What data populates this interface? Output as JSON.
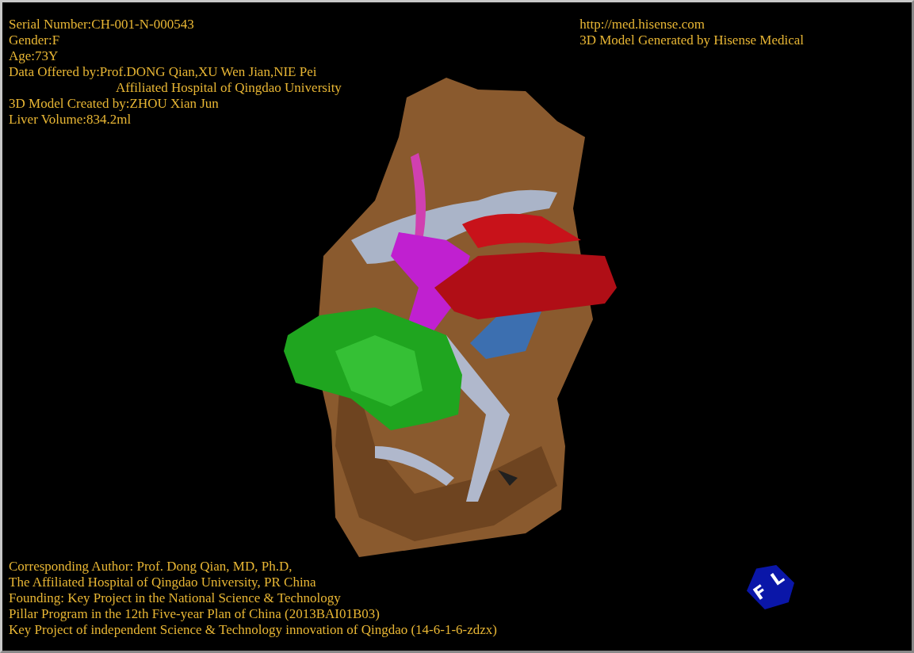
{
  "viewer": {
    "info_lines": [
      {
        "text": "Serial Number:CH-001-N-000543",
        "indented": false
      },
      {
        "text": "Gender:F",
        "indented": false
      },
      {
        "text": "Age:73Y",
        "indented": false
      },
      {
        "text": "Data Offered by:Prof.DONG Qian,XU Wen Jian,NIE Pei",
        "indented": false
      },
      {
        "text": "Affiliated Hospital of Qingdao University",
        "indented": true
      },
      {
        "text": "3D Model Created by:ZHOU Xian Jun",
        "indented": false
      },
      {
        "text": "Liver Volume:834.2ml",
        "indented": false
      }
    ],
    "site_lines": [
      "http://med.hisense.com",
      "3D Model Generated by Hisense Medical"
    ],
    "orientation_cube": {
      "face_letters": [
        "F",
        "L"
      ]
    },
    "credit_lines": [
      "Corresponding Author: Prof. Dong Qian, MD, Ph.D,",
      "The Affiliated Hospital of Qingdao University, PR China",
      "Founding: Key Project in the National Science & Technology",
      "Pillar Program in the 12th Five-year Plan of China (2013BAI01B03)",
      "Key Project of independent Science & Technology innovation of Qingdao (14-6-1-6-zdzx)"
    ]
  }
}
